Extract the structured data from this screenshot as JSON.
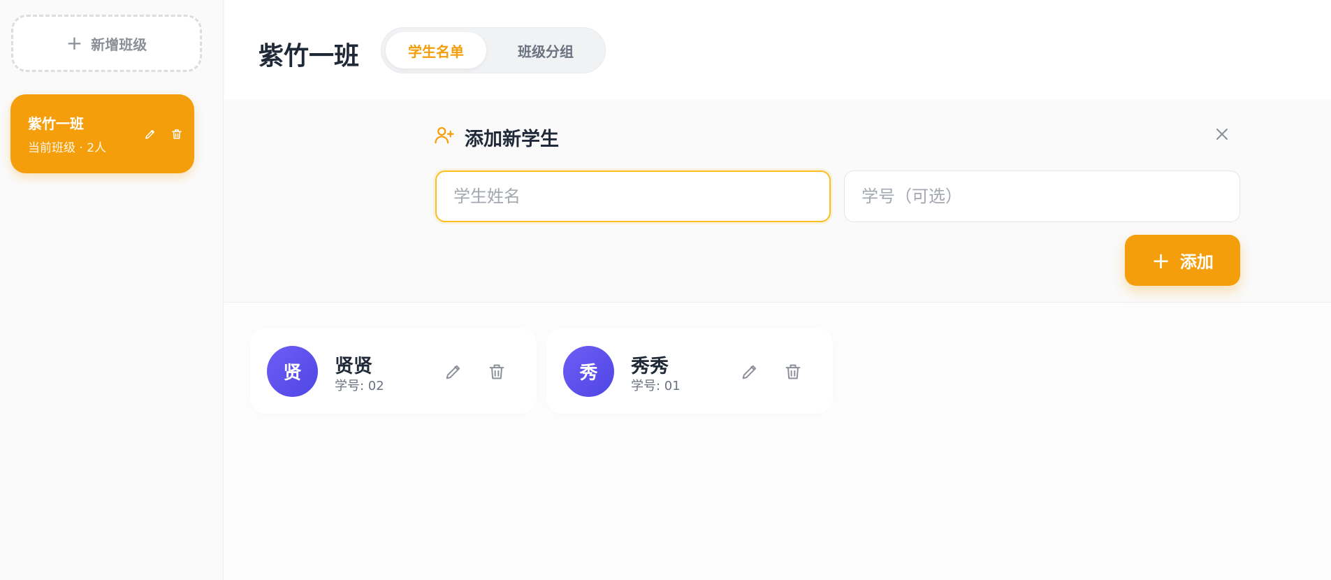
{
  "sidebar": {
    "add_class_label": "新增班级",
    "classes": [
      {
        "name": "紫竹一班",
        "meta": "当前班级 · 2人"
      }
    ]
  },
  "header": {
    "title": "紫竹一班",
    "tabs": [
      {
        "label": "学生名单",
        "active": true
      },
      {
        "label": "班级分组",
        "active": false
      }
    ]
  },
  "add_panel": {
    "title": "添加新学生",
    "name_placeholder": "学生姓名",
    "name_value": "",
    "id_placeholder": "学号（可选）",
    "id_value": "",
    "add_label": "添加"
  },
  "students": [
    {
      "avatar": "贤",
      "name": "贤贤",
      "id": "学号: 02"
    },
    {
      "avatar": "秀",
      "name": "秀秀",
      "id": "学号: 01"
    }
  ],
  "icons": {
    "plus": "plus-icon",
    "edit": "pencil-icon",
    "delete": "trash-icon",
    "add_user": "user-plus-icon",
    "close": "close-icon"
  },
  "colors": {
    "accent": "#f59e0b",
    "avatar": "#5b50ee",
    "muted": "#8a8f98"
  }
}
